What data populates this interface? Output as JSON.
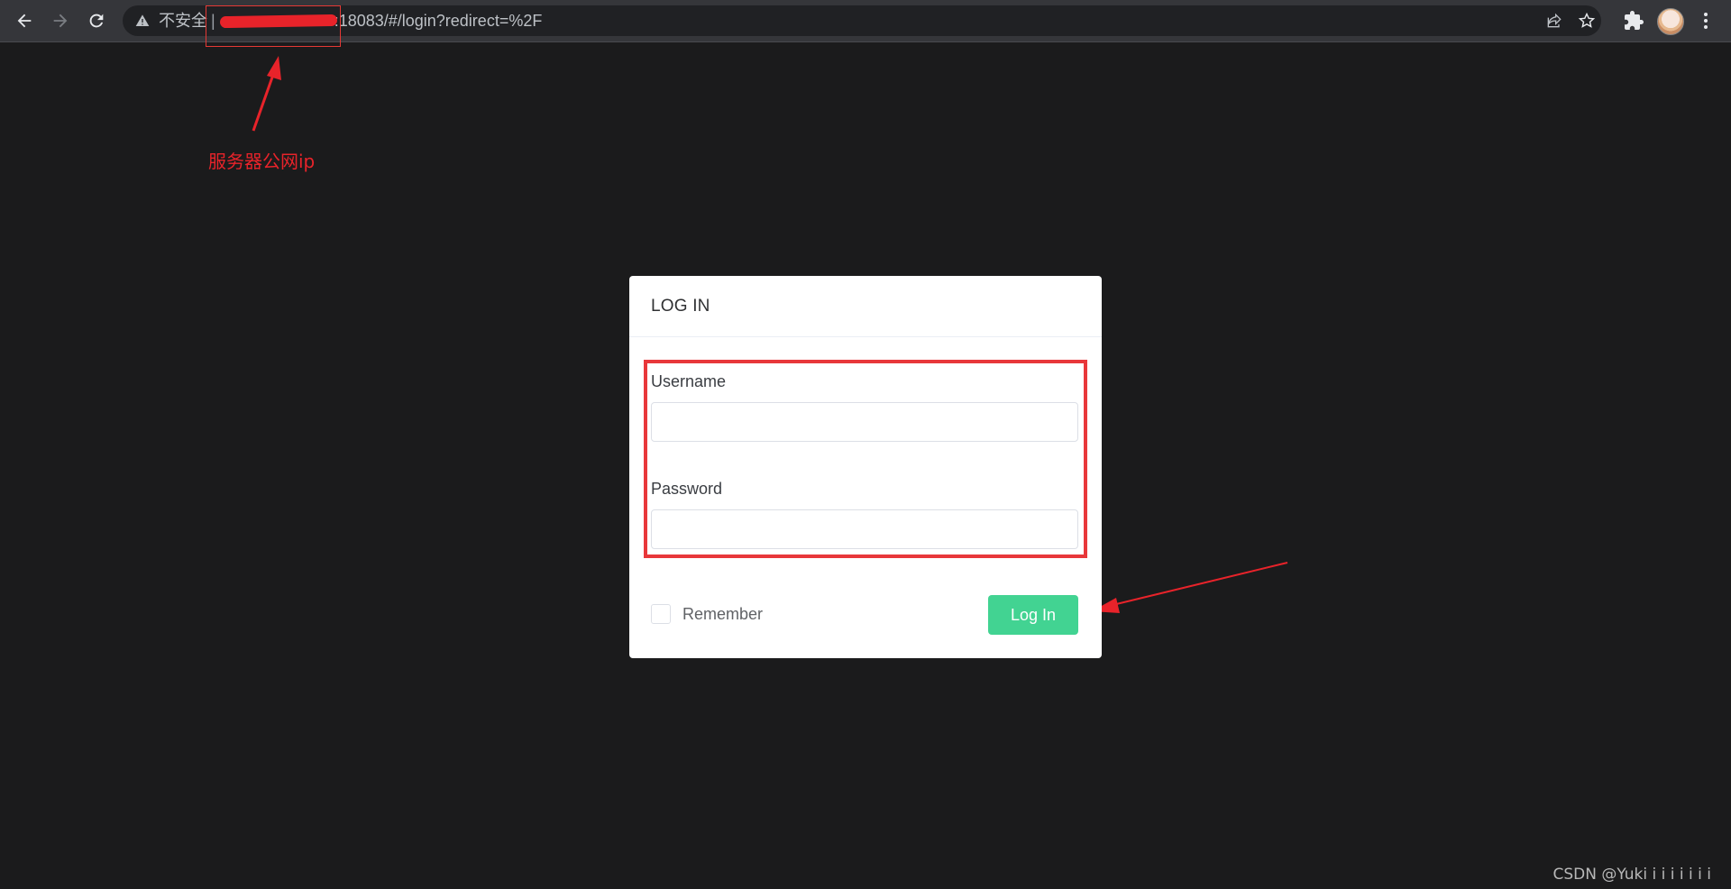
{
  "browser": {
    "security_label": "不安全",
    "separator": "|",
    "url_suffix": ":18083/#/login?redirect=%2F"
  },
  "annotation": {
    "label": "服务器公网ip"
  },
  "login": {
    "title": "LOG IN",
    "username_label": "Username",
    "username_value": "",
    "password_label": "Password",
    "password_value": "",
    "remember_label": "Remember",
    "remember_checked": false,
    "submit_label": "Log In"
  },
  "colors": {
    "page_bg": "#1b1b1c",
    "button": "#42d392",
    "annotation": "#e8232a"
  },
  "watermark": "CSDN @Yuki i i i i i i i"
}
